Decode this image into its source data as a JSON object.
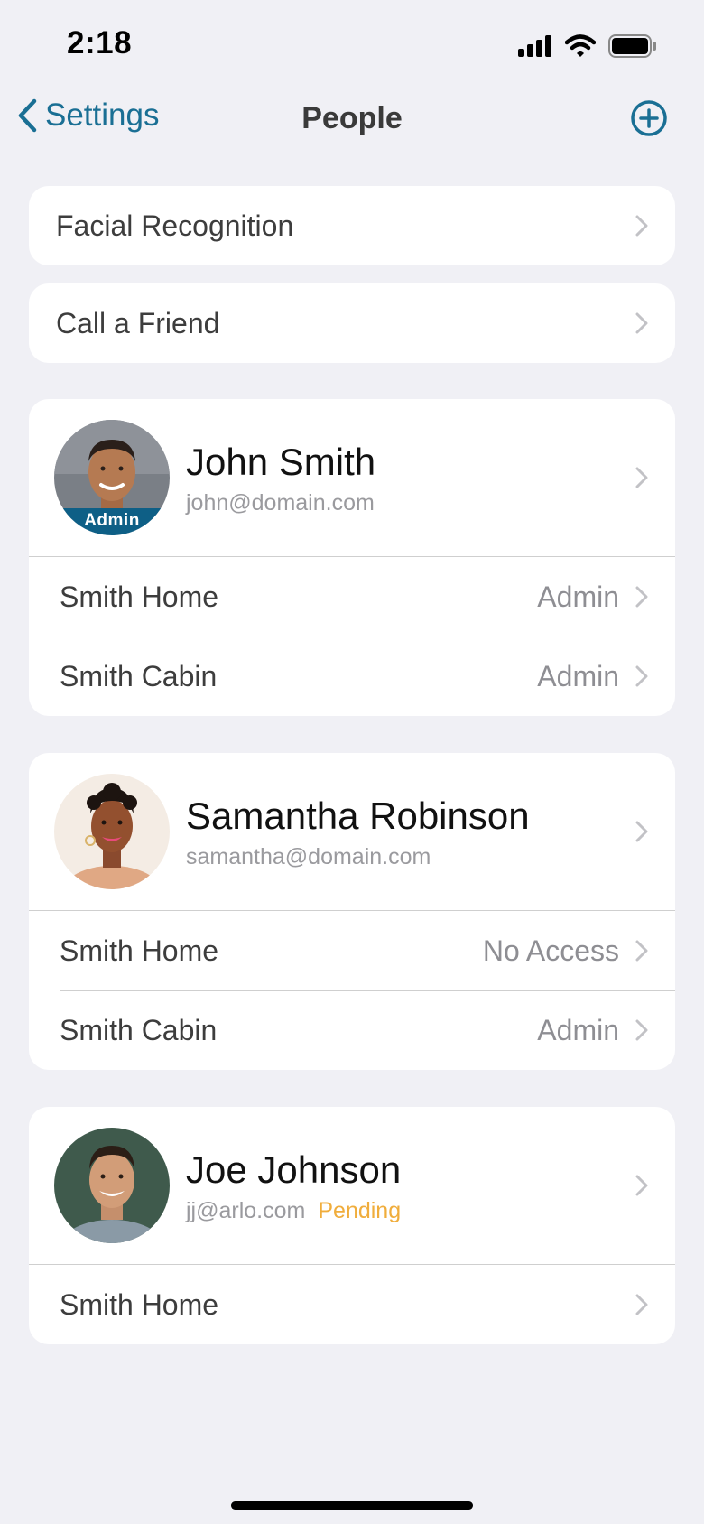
{
  "status_bar": {
    "time": "2:18"
  },
  "nav": {
    "back_label": "Settings",
    "title": "People"
  },
  "menu": [
    {
      "label": "Facial Recognition"
    },
    {
      "label": "Call a Friend"
    }
  ],
  "people": [
    {
      "name": "John Smith",
      "email": "john@domain.com",
      "badge": "Admin",
      "status": "",
      "locations": [
        {
          "name": "Smith Home",
          "role": "Admin"
        },
        {
          "name": "Smith Cabin",
          "role": "Admin"
        }
      ]
    },
    {
      "name": "Samantha Robinson",
      "email": "samantha@domain.com",
      "badge": "",
      "status": "",
      "locations": [
        {
          "name": "Smith Home",
          "role": "No Access"
        },
        {
          "name": "Smith Cabin",
          "role": "Admin"
        }
      ]
    },
    {
      "name": "Joe Johnson",
      "email": "jj@arlo.com",
      "badge": "",
      "status": "Pending",
      "locations": [
        {
          "name": "Smith Home",
          "role": ""
        }
      ]
    }
  ],
  "colors": {
    "accent": "#1a6f94",
    "pending": "#f0ad3c",
    "admin_badge": "#0e5f86",
    "background": "#f0f0f5"
  }
}
